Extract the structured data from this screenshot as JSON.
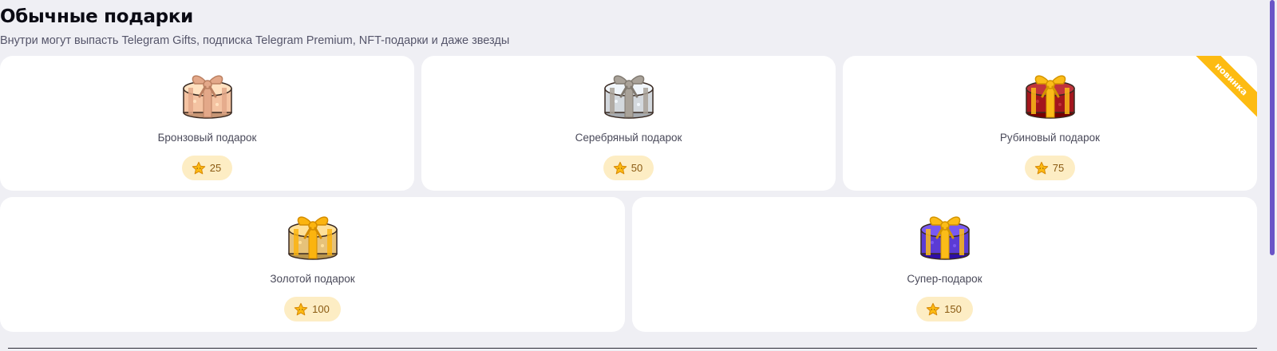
{
  "section": {
    "title": "Обычные подарки",
    "subtitle": "Внутри могут выпасть Telegram Gifts, подписка Telegram Premium, NFT-подарки и даже звезды"
  },
  "gifts": [
    {
      "name": "Бронзовый подарок",
      "price": "25",
      "icon": "gift-box-bronze-icon",
      "box_color": "#f4c3a2",
      "ribbon_color": "#e3a889",
      "badge": ""
    },
    {
      "name": "Серебряный подарок",
      "price": "50",
      "icon": "gift-box-silver-icon",
      "box_color": "#d3d8dd",
      "ribbon_color": "#a9a299",
      "badge": ""
    },
    {
      "name": "Рубиновый подарок",
      "price": "75",
      "icon": "gift-box-ruby-icon",
      "box_color": "#a3161d",
      "ribbon_color": "#fbbc18",
      "badge": "новинка"
    },
    {
      "name": "Золотой подарок",
      "price": "100",
      "icon": "gift-box-gold-icon",
      "box_color": "#e6c27a",
      "ribbon_color": "#fbb40f",
      "badge": ""
    },
    {
      "name": "Супер-подарок",
      "price": "150",
      "icon": "gift-box-super-icon",
      "box_color": "#5b3bd4",
      "ribbon_color": "#fbbc18",
      "badge": ""
    }
  ],
  "colors": {
    "background": "#efeff4",
    "card": "#ffffff",
    "price_badge": "#fdedc4",
    "accent": "#fdbb12",
    "scrollbar": "#6b55c7"
  }
}
